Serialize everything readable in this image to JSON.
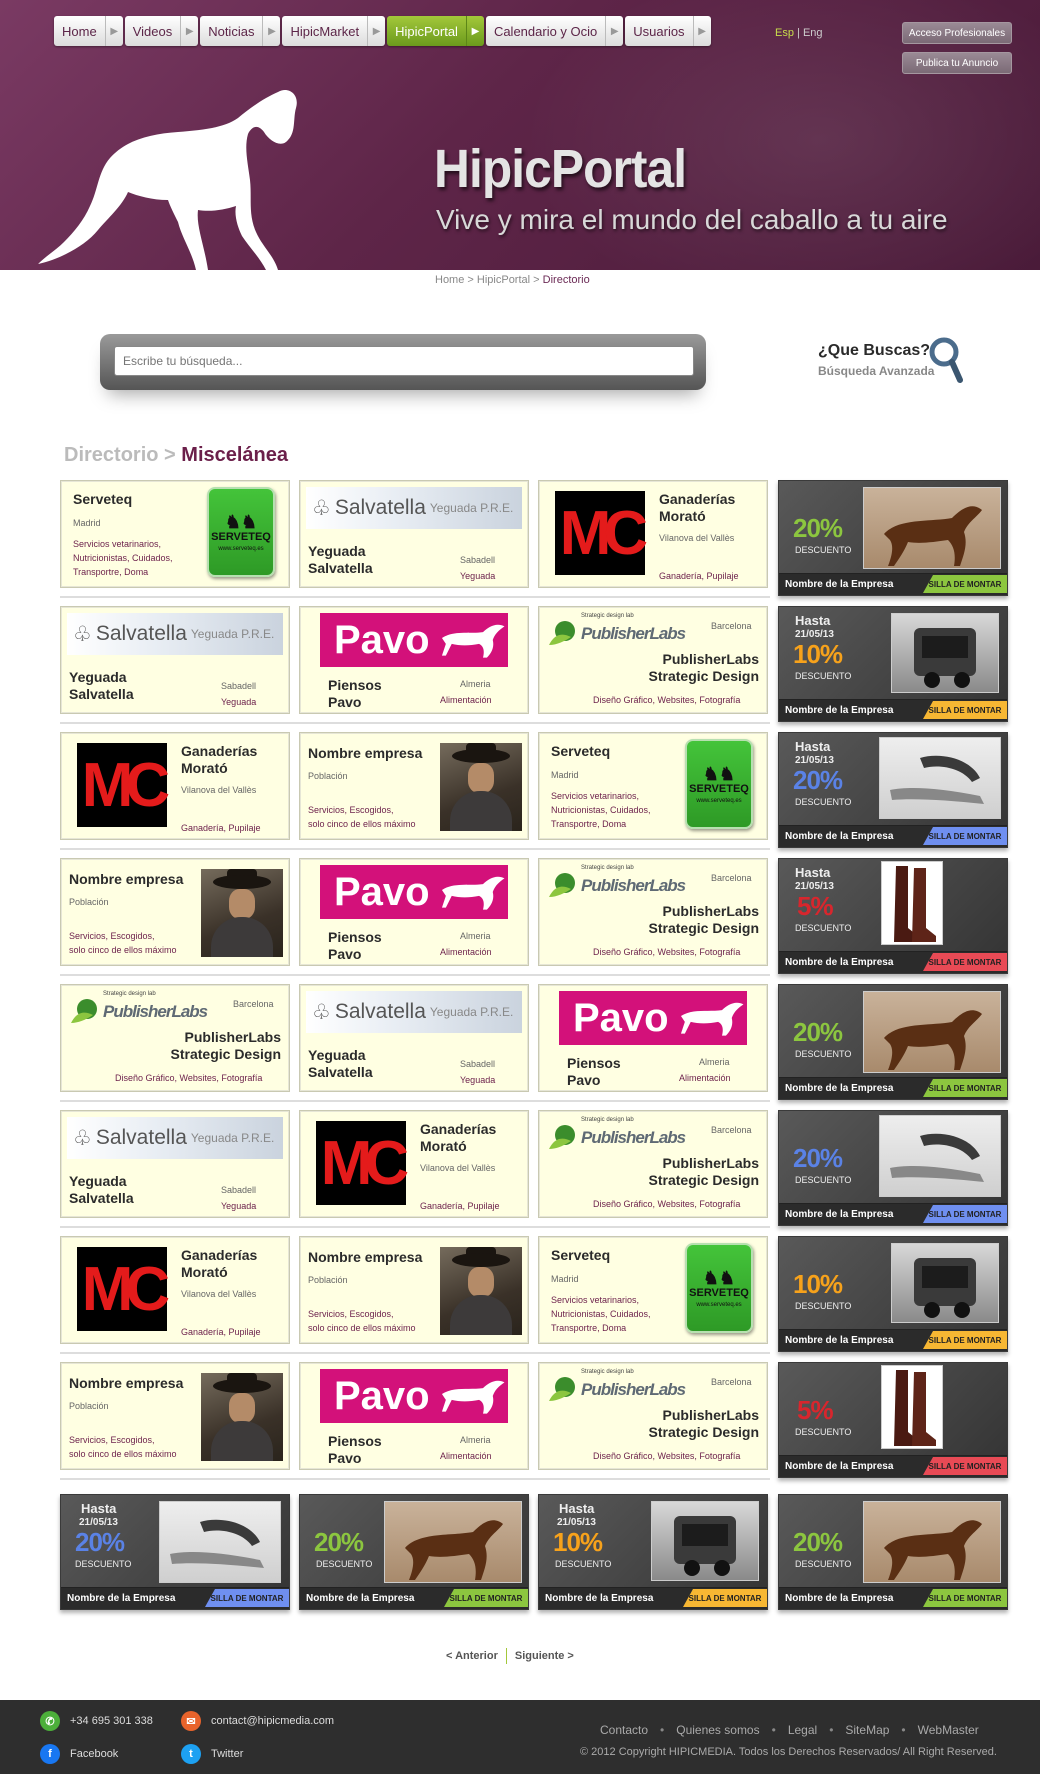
{
  "nav": {
    "items": [
      {
        "label": "Home",
        "active": false
      },
      {
        "label": "Videos",
        "active": false
      },
      {
        "label": "Noticias",
        "active": false
      },
      {
        "label": "HipicMarket",
        "active": false
      },
      {
        "label": "HipicPortal",
        "active": true
      },
      {
        "label": "Calendario y Ocio",
        "active": false
      },
      {
        "label": "Usuarios",
        "active": false
      }
    ]
  },
  "lang": {
    "es": "Esp",
    "en": "Eng"
  },
  "header_buttons": {
    "pro": "Acceso Profesionales",
    "publica": "Publica tu Anuncio"
  },
  "brand": {
    "title": "HipicPortal",
    "tagline": "Vive y mira el mundo del caballo a tu aire"
  },
  "breadcrumb": {
    "home": "Home",
    "sep": ">",
    "portal": "HipicPortal",
    "current": "Directorio"
  },
  "search": {
    "placeholder": "Escribe tu búsqueda...",
    "title": "¿Que Buscas?",
    "advanced": "Búsqueda Avanzada"
  },
  "directory": {
    "title": "Directorio",
    "sep": ">",
    "category": "Miscelánea"
  },
  "companies": {
    "serveteq": {
      "name": "Serveteq",
      "location": "Madrid",
      "services": [
        "Servicios vetarinarios,",
        "Nutricionistas, Cuidados,",
        "Transportre, Doma"
      ],
      "logo_text": "SERVETEQ",
      "logo_small": "www.serveteq.es"
    },
    "salvatella": {
      "name1": "Yeguada",
      "name2": "Salvatella",
      "location": "Sabadell",
      "services": "Yeguada",
      "logo1": "Salvatella",
      "logo2": "Yeguada P.R.E."
    },
    "morato": {
      "name1": "Ganaderías",
      "name2": "Morató",
      "location": "Vilanova del Vallès",
      "services": "Ganadería, Pupilaje",
      "logo": "MC"
    },
    "pavo": {
      "name1": "Piensos",
      "name2": "Pavo",
      "location": "Almeria",
      "services": "Alimentación",
      "logo": "Pavo"
    },
    "publisher": {
      "name1": "PublisherLabs",
      "name2": "Strategic Design",
      "location": "Barcelona",
      "services": "Diseño Gráfico, Websites, Fotografía",
      "logo": "PublisherLabs",
      "logo_small": "Strategic design lab"
    },
    "generic": {
      "name": "Nombre empresa",
      "location": "Población",
      "services": [
        "Servicios, Escogidos,",
        "solo cinco de ellos máximo"
      ]
    }
  },
  "promo_common": {
    "company": "Nombre de la Empresa",
    "tag": "SILLA DE MONTAR",
    "desc": "DESCUENTO",
    "hasta": "Hasta",
    "date": "21/05/13"
  },
  "promos": {
    "p20g": {
      "percent": "20%",
      "color": "#8cc63f",
      "tag_color": "#8cc63f"
    },
    "p10o": {
      "percent": "10%",
      "color": "#f7a21b",
      "tag_color": "#f7b733"
    },
    "p20b": {
      "percent": "20%",
      "color": "#5a82e6",
      "tag_color": "#6f8ff0"
    },
    "p5r": {
      "percent": "5%",
      "color": "#d8262d",
      "tag_color": "#e84a55"
    }
  },
  "pager": {
    "prev": "< Anterior",
    "next": "Siguiente >"
  },
  "footer": {
    "phone": "+34 695 301 338",
    "email": "contact@hipicmedia.com",
    "facebook": "Facebook",
    "twitter": "Twitter",
    "links": [
      "Contacto",
      "Quienes somos",
      "Legal",
      "SiteMap",
      "WebMaster"
    ],
    "copyright": "© 2012 Copyright HIPICMEDIA. Todos los Derechos Reservados/ All Right Reserved."
  }
}
